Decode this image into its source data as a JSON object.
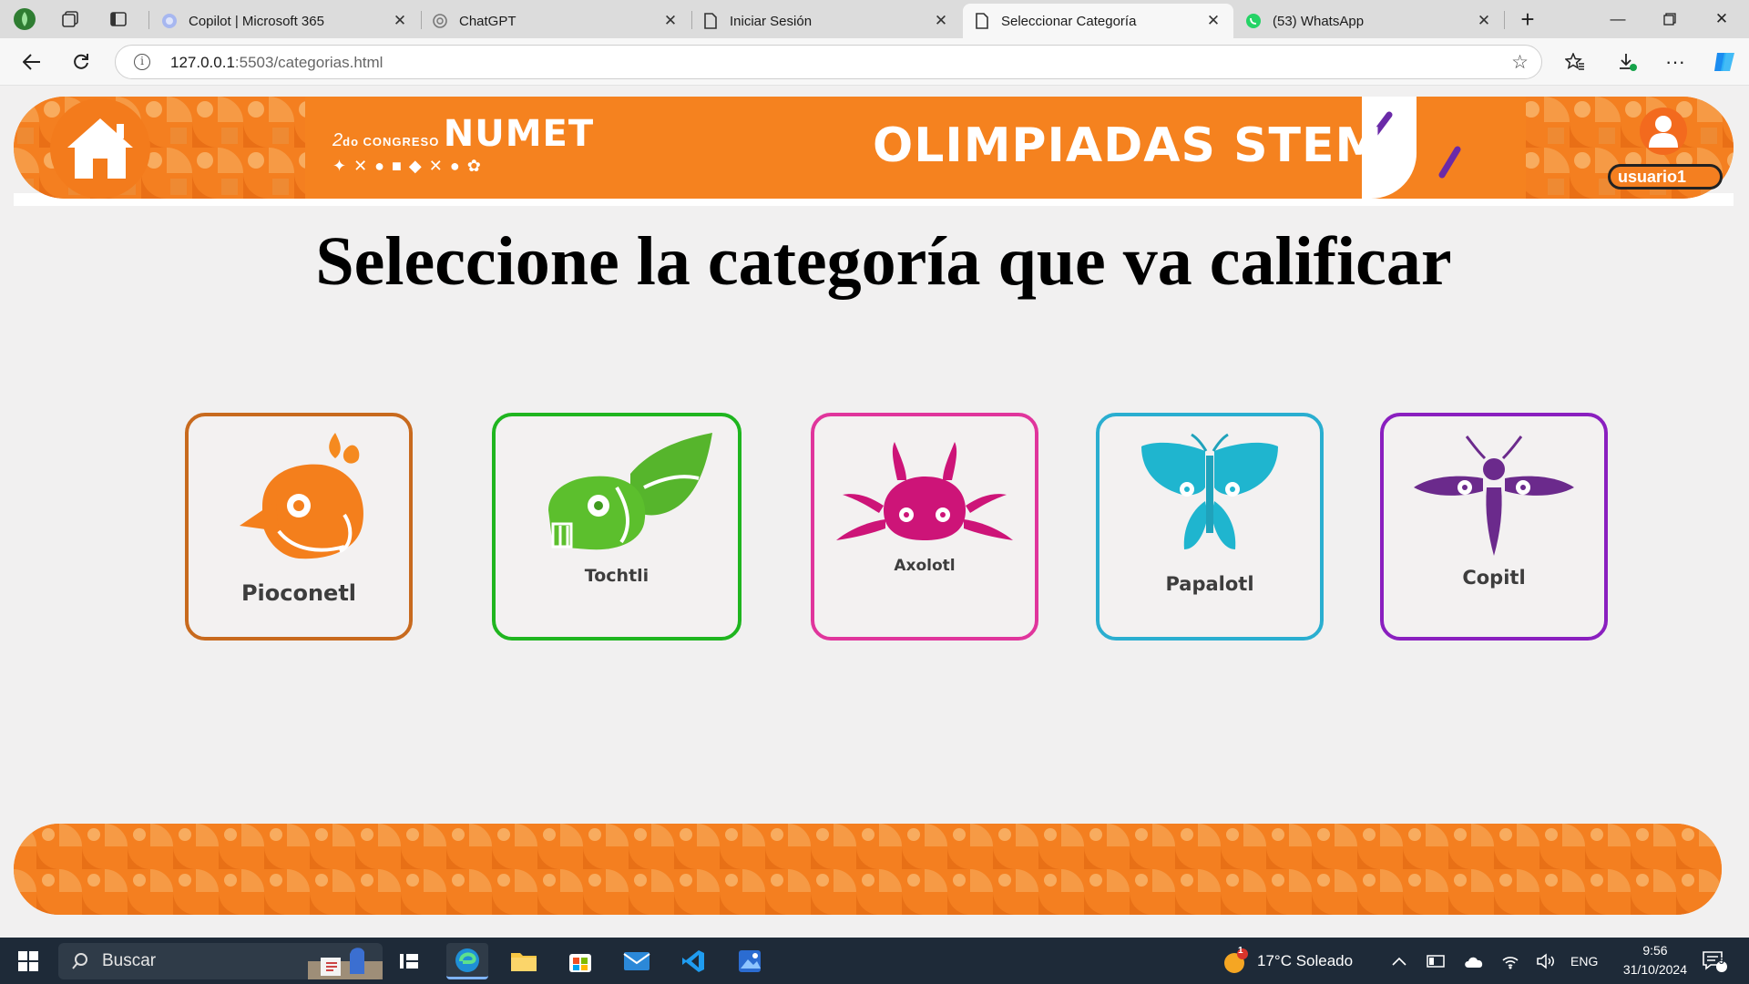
{
  "browser": {
    "tabs": [
      {
        "label": "Copilot | Microsoft 365",
        "favicon": "copilot-icon",
        "active": false
      },
      {
        "label": "ChatGPT",
        "favicon": "chatgpt-icon",
        "active": false
      },
      {
        "label": "Iniciar Sesión",
        "favicon": "page-icon",
        "active": false
      },
      {
        "label": "Seleccionar Categoría",
        "favicon": "page-icon",
        "active": true
      },
      {
        "label": "(53) WhatsApp",
        "favicon": "whatsapp-icon",
        "active": false
      }
    ],
    "url_host": "127.0.0.1",
    "url_rest": ":5503/categorias.html"
  },
  "header": {
    "congress_prefix": "2",
    "congress_sup": "do",
    "congress_word": "CONGRESO",
    "congress_name": "NUMET",
    "title": "OLIMPIADAS STEM",
    "username": "usuario1"
  },
  "page": {
    "title": "Seleccione la categoría que va calificar"
  },
  "categories": [
    {
      "label": "Pioconetl",
      "color": "#c86a1e",
      "icon": "bird-icon"
    },
    {
      "label": "Tochtli",
      "color": "#1fb51f",
      "icon": "rabbit-icon"
    },
    {
      "label": "Axolotl",
      "color": "#e0359c",
      "icon": "axolotl-icon"
    },
    {
      "label": "Papalotl",
      "color": "#2aaed0",
      "icon": "butterfly-icon"
    },
    {
      "label": "Copitl",
      "color": "#8a1fbf",
      "icon": "dragonfly-icon"
    }
  ],
  "taskbar": {
    "search_placeholder": "Buscar",
    "weather": "17°C Soleado",
    "weather_badge": "1",
    "language": "ENG",
    "time": "9:56",
    "date": "31/10/2024",
    "notifications": "5"
  }
}
